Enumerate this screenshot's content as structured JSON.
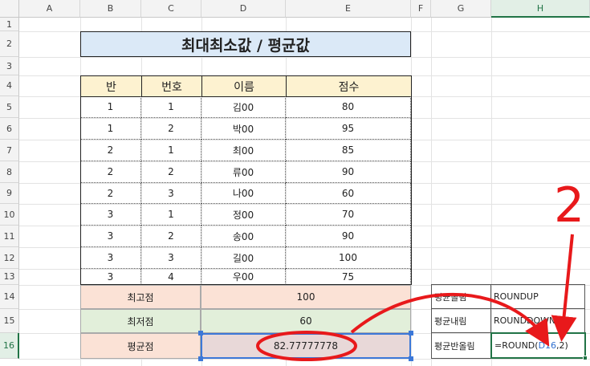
{
  "columns": [
    "A",
    "B",
    "C",
    "D",
    "E",
    "F",
    "G",
    "H"
  ],
  "rows": [
    "1",
    "2",
    "3",
    "4",
    "5",
    "6",
    "7",
    "8",
    "9",
    "10",
    "11",
    "12",
    "13",
    "14",
    "15",
    "16"
  ],
  "title": "최대최소값 / 평균값",
  "table": {
    "headers": [
      "반",
      "번호",
      "이름",
      "점수"
    ],
    "rows": [
      [
        "1",
        "1",
        "김00",
        "80"
      ],
      [
        "1",
        "2",
        "박00",
        "95"
      ],
      [
        "2",
        "1",
        "최00",
        "85"
      ],
      [
        "2",
        "2",
        "류00",
        "90"
      ],
      [
        "2",
        "3",
        "나00",
        "60"
      ],
      [
        "3",
        "1",
        "정00",
        "70"
      ],
      [
        "3",
        "2",
        "송00",
        "90"
      ],
      [
        "3",
        "3",
        "길00",
        "100"
      ],
      [
        "3",
        "4",
        "우00",
        "75"
      ]
    ]
  },
  "summary": {
    "max_label": "최고점",
    "max_value": "100",
    "min_label": "최저점",
    "min_value": "60",
    "avg_label": "평균점",
    "avg_value": "82.77777778"
  },
  "side_table": {
    "r14_label": "평균올림",
    "r14_func": "ROUNDUP",
    "r15_label": "평균내림",
    "r15_func": "ROUNDDOWN",
    "r16_label": "평균반올림",
    "r16_formula_pre": "=ROUND(",
    "r16_formula_ref": "D16",
    "r16_formula_post": ",2)"
  },
  "annotation": {
    "number": "2"
  },
  "colors": {
    "title_bg": "#dbe9f7",
    "header_bg": "#fdf2d0",
    "max_bg": "#fbe2d6",
    "min_bg": "#e2efda",
    "avg_bg": "#fbe2d6",
    "avg_value_bg": "#e8d8d8",
    "annotation_red": "#e8191b",
    "selection_green": "#217346",
    "ref_blue": "#2f6fd0",
    "ref_border": "#3c78d8"
  }
}
